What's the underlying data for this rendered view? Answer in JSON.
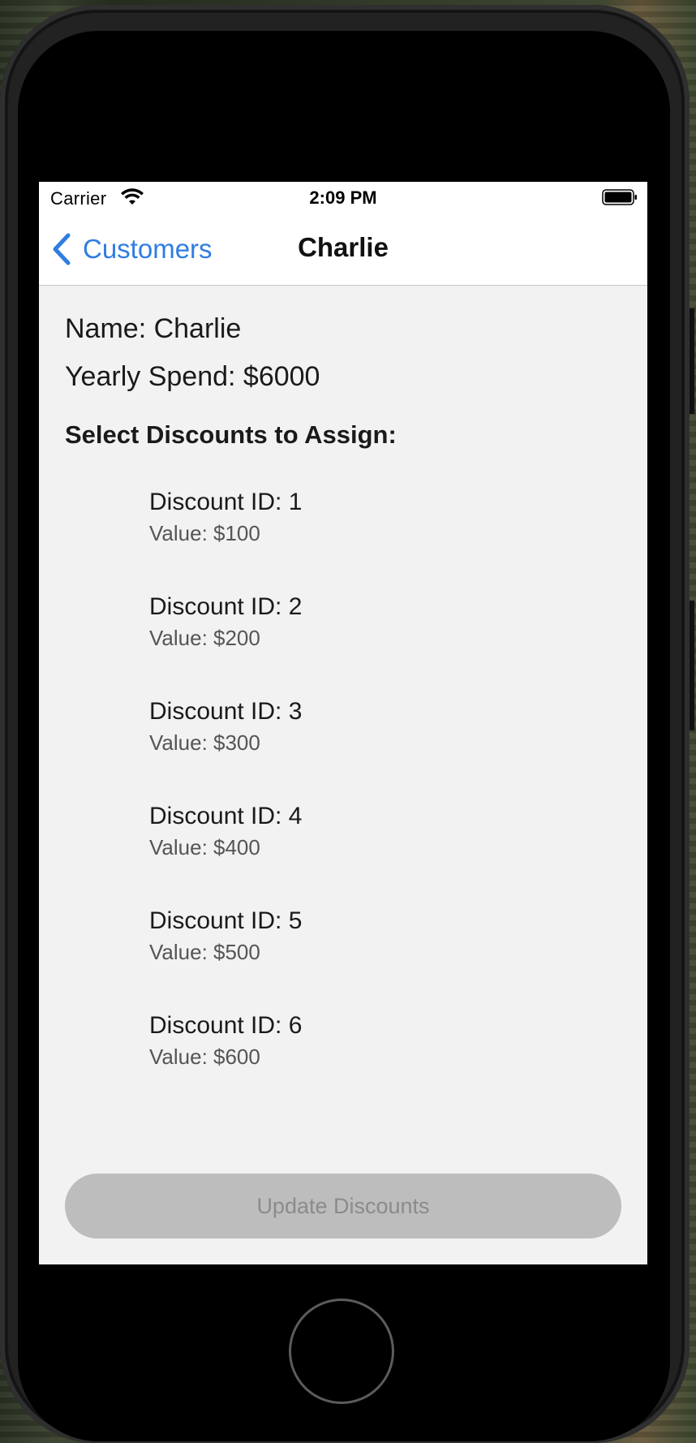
{
  "status_bar": {
    "carrier": "Carrier",
    "time": "2:09 PM",
    "wifi_icon": "wifi-icon",
    "battery_icon": "battery-full-icon"
  },
  "nav": {
    "back_label": "Customers",
    "back_icon": "chevron-left-icon",
    "title": "Charlie",
    "accent_color": "#2f7de1"
  },
  "customer": {
    "name_line": "Name: Charlie",
    "spend_line": "Yearly Spend: $6000"
  },
  "section_heading": "Select Discounts to Assign:",
  "discounts": [
    {
      "title": "Discount ID: 1",
      "value": "Value: $100"
    },
    {
      "title": "Discount ID: 2",
      "value": "Value: $200"
    },
    {
      "title": "Discount ID: 3",
      "value": "Value: $300"
    },
    {
      "title": "Discount ID: 4",
      "value": "Value: $400"
    },
    {
      "title": "Discount ID: 5",
      "value": "Value: $500"
    },
    {
      "title": "Discount ID: 6",
      "value": "Value: $600"
    }
  ],
  "update_button": {
    "label": "Update Discounts",
    "state": "disabled"
  },
  "device": {
    "home_button": "home-button"
  }
}
